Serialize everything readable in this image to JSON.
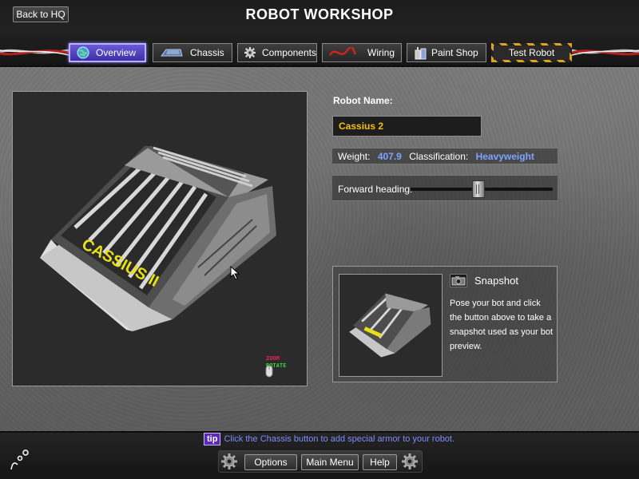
{
  "header": {
    "back_label": "Back to HQ",
    "title": "ROBOT WORKSHOP"
  },
  "tabs": [
    {
      "label": "Overview",
      "icon": "globe-icon",
      "active": true
    },
    {
      "label": "Chassis",
      "icon": "chassis-icon"
    },
    {
      "label": "Components",
      "icon": "gear-icon"
    },
    {
      "label": "Wiring",
      "icon": "wire-icon"
    },
    {
      "label": "Paint Shop",
      "icon": "paint-can-icon"
    },
    {
      "label": "Test Robot",
      "icon": ""
    }
  ],
  "viewport": {
    "zoom_label": "ZOOM",
    "rotate_label": "ROTATE",
    "robot_decal": "CASSIUS II"
  },
  "robot": {
    "name_label": "Robot Name:",
    "name": "Cassius 2",
    "weight_label": "Weight:",
    "weight": "407.9",
    "class_label": "Classification:",
    "classification": "Heavyweight",
    "heading_label": "Forward heading:",
    "heading_value": 0.48
  },
  "snapshot": {
    "title": "Snapshot",
    "description": "Pose your bot and click the button above to take a snapshot used as your bot preview."
  },
  "footer": {
    "tip_badge": "tip",
    "tip_text": "Click the Chassis button to add special armor to your robot.",
    "options_label": "Options",
    "main_menu_label": "Main Menu",
    "help_label": "Help"
  },
  "colors": {
    "accent_tab": "#5a4ad0",
    "robot_name": "#f4c10d",
    "info_value": "#7da4ff",
    "tip_text": "#7d8cff"
  }
}
